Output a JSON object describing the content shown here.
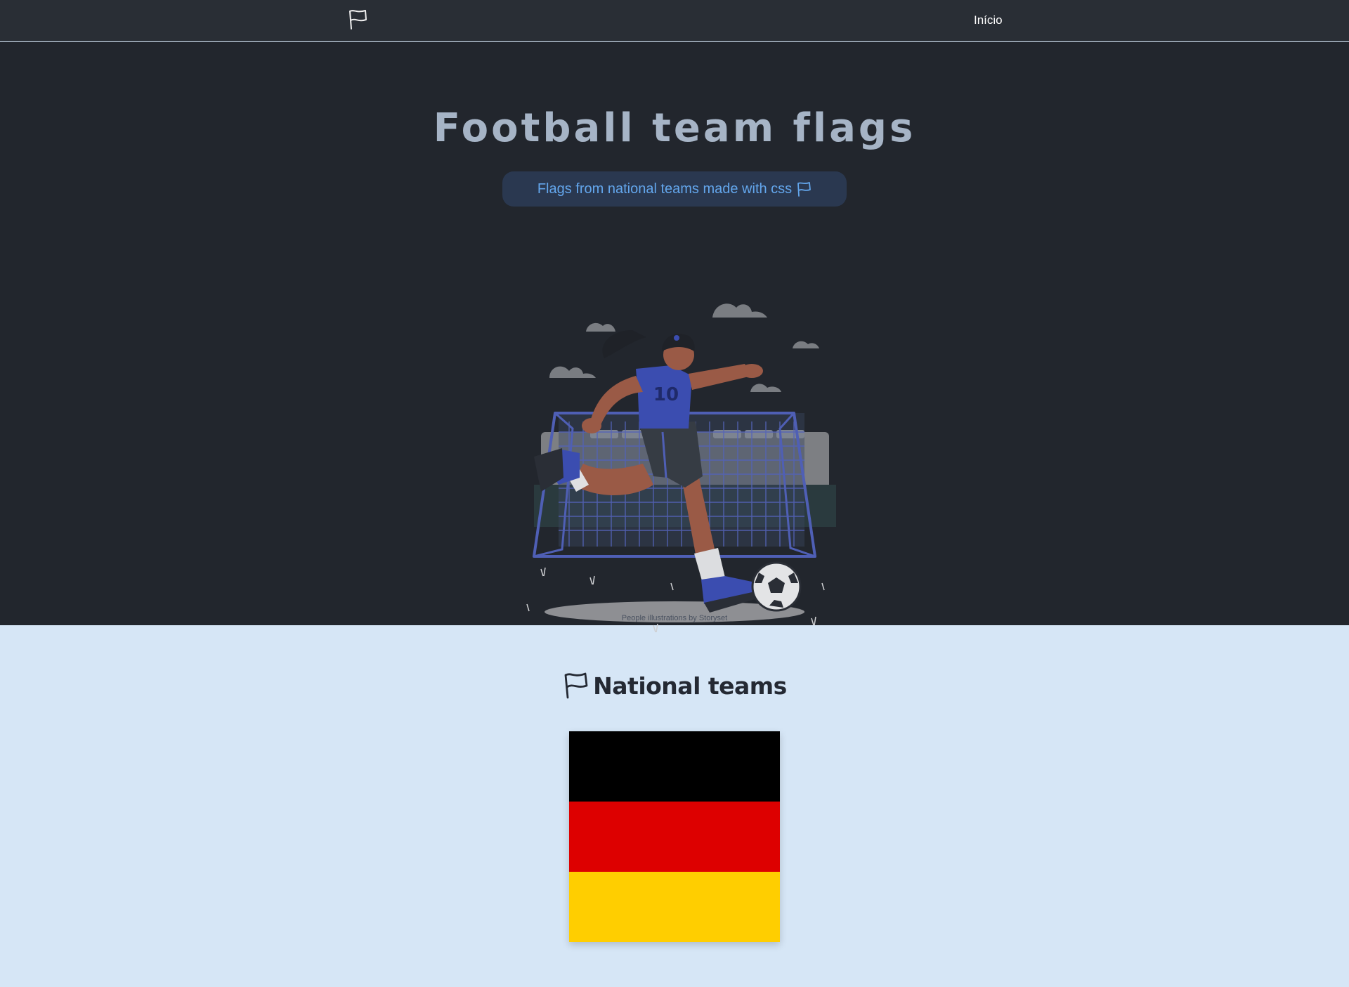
{
  "nav": {
    "logo_icon": "flag-icon",
    "link_label": "Início"
  },
  "hero": {
    "title": "Football team flags",
    "subtitle": "Flags from national teams made with css",
    "subtitle_icon": "flag-icon",
    "illustration": "woman-kicking-football-illustration",
    "credit": "People illustrations by Storyset"
  },
  "section": {
    "title": "National teams",
    "title_icon": "flag-icon"
  },
  "flags": [
    {
      "team": "germany",
      "stripes": [
        "#000000",
        "#dd0000",
        "#ffce00"
      ]
    }
  ],
  "colors": {
    "nav_bg": "#292e35",
    "hero_bg": "#22262d",
    "hero_title": "#a6b4c6",
    "pill_bg": "#2a3850",
    "pill_text": "#63a6ec",
    "section_bg": "#d6e6f6",
    "player_jersey": "#3b4db0",
    "goal_net": "#5463b8"
  }
}
